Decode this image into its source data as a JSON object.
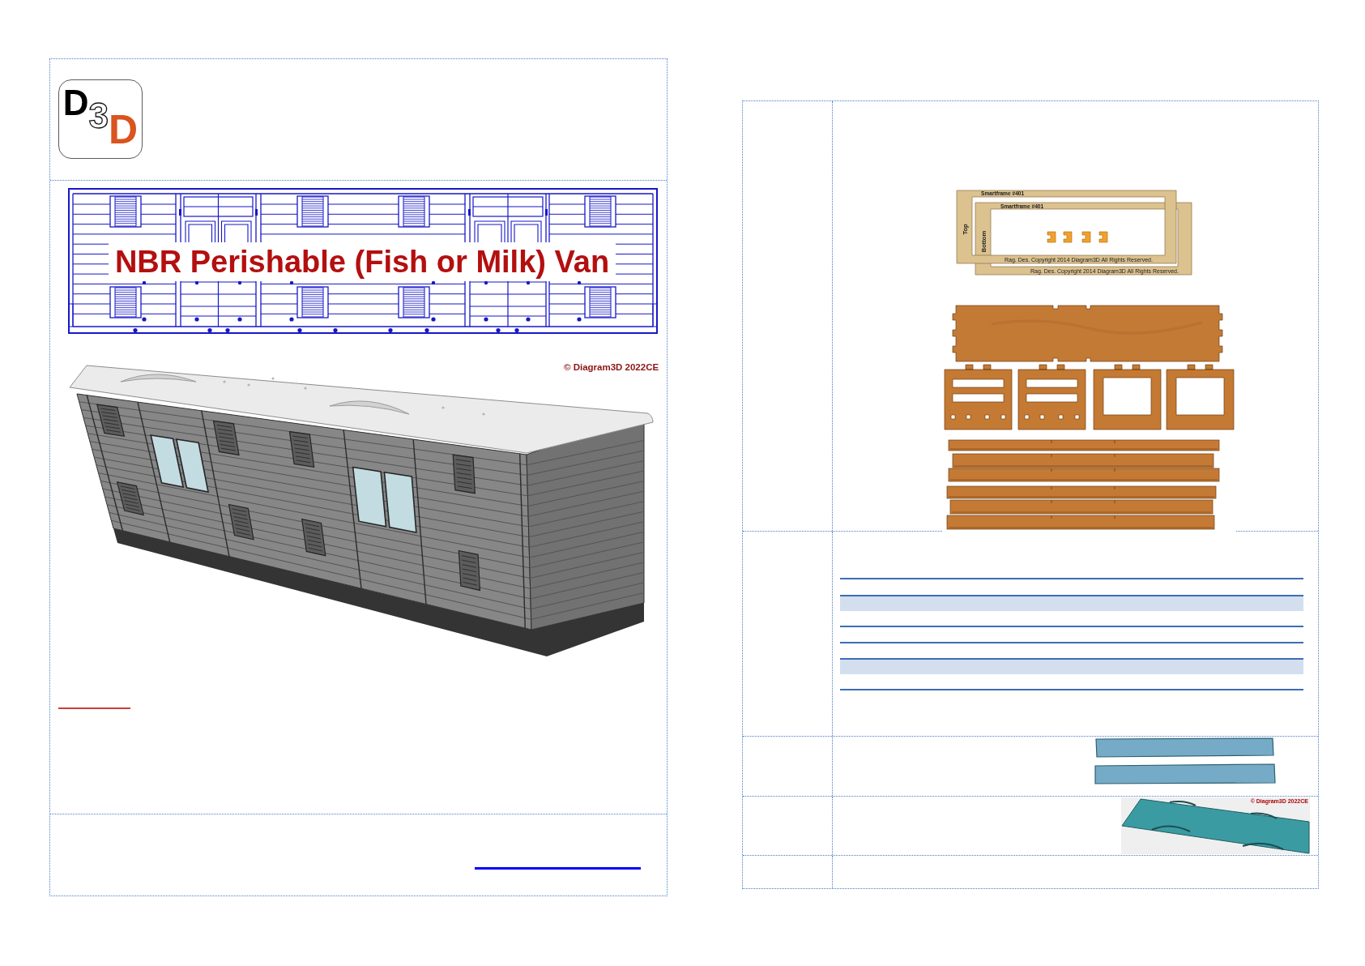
{
  "left_page": {
    "header": {
      "logo": {
        "letters": [
          {
            "char": "D",
            "kind": "solid"
          },
          {
            "char": "3",
            "kind": "outline"
          },
          {
            "char": "D",
            "kind": "accent"
          }
        ]
      }
    },
    "body": {
      "blueprint": {
        "title": "NBR Perishable (Fish or Milk) Van"
      },
      "render": {
        "caption": "© Diagram3D 2022CE"
      }
    }
  },
  "right_page": {
    "rows": [
      {
        "kind": "parts",
        "frames": [
          {
            "title": "Smartframe #401",
            "side": "Top",
            "copyright": "Rag. Des. Copyright 2014 Diagram3D All Rights Reserved."
          },
          {
            "title": "Smartframe #401",
            "side": "Bottom",
            "copyright": "Rag. Des. Copyright 2014 Diagram3D All Rights Reserved."
          }
        ]
      },
      {
        "kind": "ruled_table",
        "rows": [
          {
            "kind": "header"
          },
          {
            "kind": "band"
          },
          {
            "kind": "ruled"
          },
          {
            "kind": "ruled"
          },
          {
            "kind": "ruled"
          },
          {
            "kind": "band"
          },
          {
            "kind": "ruled"
          }
        ]
      },
      {
        "kind": "glazing"
      },
      {
        "kind": "roof",
        "caption": "© Diagram3D 2022CE"
      },
      {
        "kind": "blank"
      }
    ]
  }
}
